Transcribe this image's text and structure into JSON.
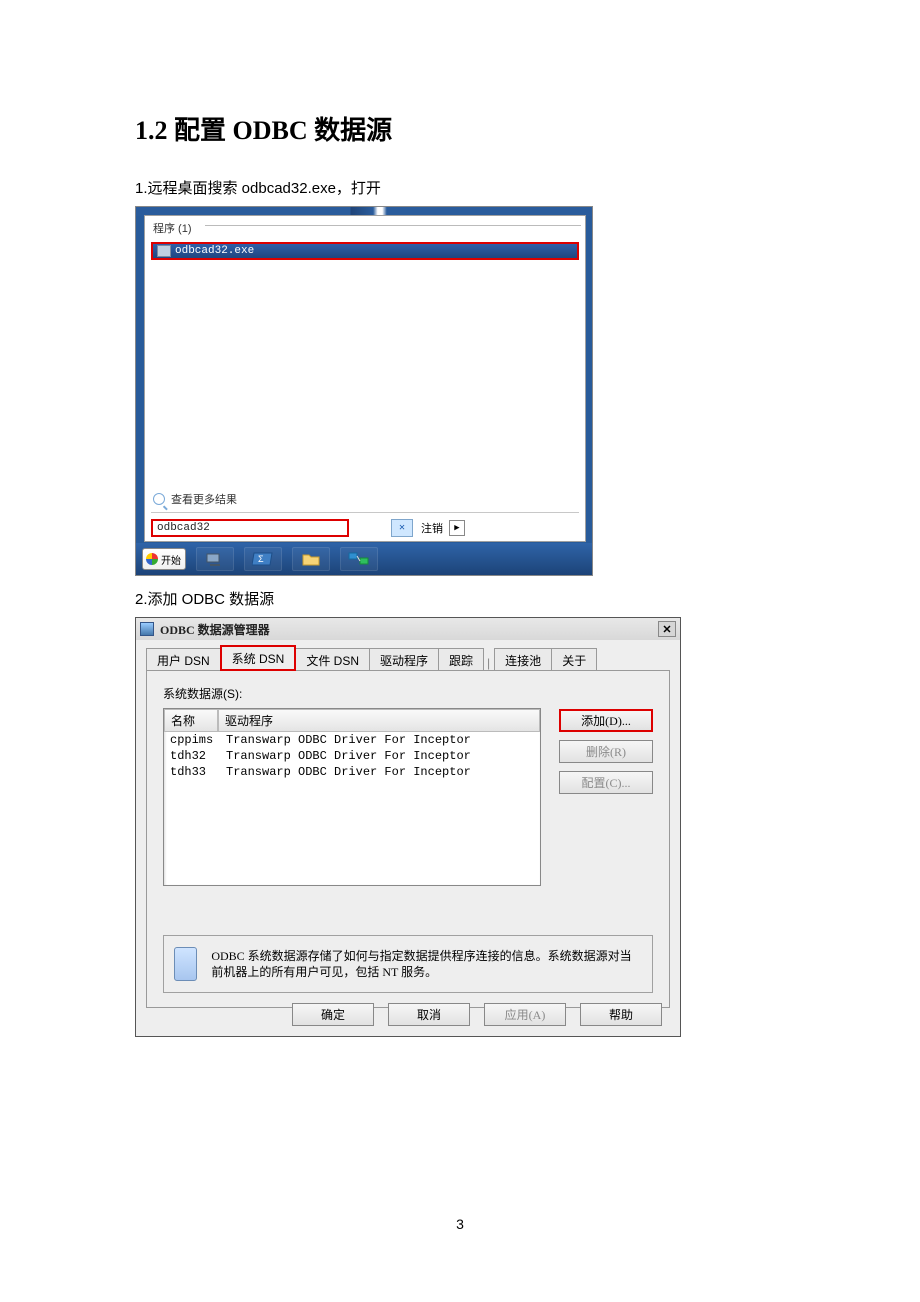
{
  "section_heading": "1.2 配置 ODBC 数据源",
  "step1_text": "1.远程桌面搜索 odbcad32.exe，打开",
  "step2_text": "2.添加 ODBC 数据源",
  "page_number": "3",
  "shot1": {
    "header": "程序 (1)",
    "result_label": "odbcad32.exe",
    "more_results": "查看更多结果",
    "search_value": "odbcad32",
    "close_glyph": "✕",
    "logoff": "注销",
    "arrow_glyph": "▶",
    "start_label": "开始"
  },
  "shot2": {
    "title": "ODBC 数据源管理器",
    "close_glyph": "✕",
    "tabs": {
      "user_dsn": "用户 DSN",
      "system_dsn": "系统 DSN",
      "file_dsn": "文件 DSN",
      "driver": "驱动程序",
      "trace": "跟踪",
      "pool": "连接池",
      "about": "关于"
    },
    "ds_label": "系统数据源(S):",
    "columns": {
      "name": "名称",
      "driver": "驱动程序"
    },
    "rows": [
      {
        "name": "cppims",
        "driver": "Transwarp ODBC Driver For Inceptor"
      },
      {
        "name": "tdh32",
        "driver": "Transwarp ODBC Driver For Inceptor"
      },
      {
        "name": "tdh33",
        "driver": "Transwarp ODBC Driver For Inceptor"
      }
    ],
    "buttons": {
      "add": "添加(D)...",
      "remove": "删除(R)",
      "configure": "配置(C)..."
    },
    "info_text": "ODBC 系统数据源存储了如何与指定数据提供程序连接的信息。系统数据源对当前机器上的所有用户可见，包括 NT 服务。",
    "dlg": {
      "ok": "确定",
      "cancel": "取消",
      "apply": "应用(A)",
      "help": "帮助"
    }
  }
}
